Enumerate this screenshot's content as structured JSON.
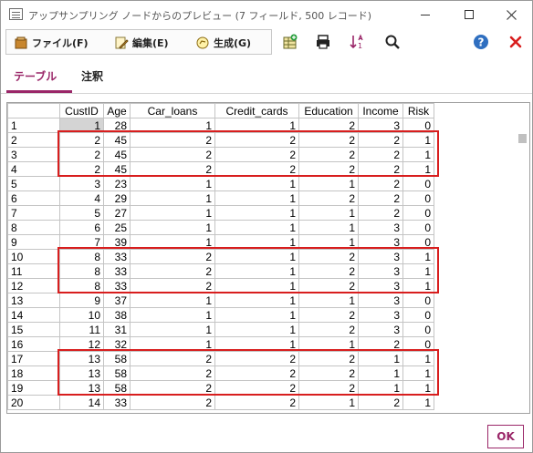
{
  "window": {
    "title": "アップサンプリング ノードからのプレビュー (7 フィールド, 500 レコード)"
  },
  "menu": {
    "file_label": "ファイル(F)",
    "edit_label": "編集(E)",
    "generate_label": "生成(G)"
  },
  "tabs": [
    {
      "label": "テーブル",
      "active": true
    },
    {
      "label": "注釈",
      "active": false
    }
  ],
  "table": {
    "columns": [
      "CustID",
      "Age",
      "Car_loans",
      "Credit_cards",
      "Education",
      "Income",
      "Risk"
    ],
    "rows": [
      [
        "1",
        "1",
        "28",
        "1",
        "1",
        "2",
        "3",
        "0"
      ],
      [
        "2",
        "2",
        "45",
        "2",
        "2",
        "2",
        "2",
        "1"
      ],
      [
        "3",
        "2",
        "45",
        "2",
        "2",
        "2",
        "2",
        "1"
      ],
      [
        "4",
        "2",
        "45",
        "2",
        "2",
        "2",
        "2",
        "1"
      ],
      [
        "5",
        "3",
        "23",
        "1",
        "1",
        "1",
        "2",
        "0"
      ],
      [
        "6",
        "4",
        "29",
        "1",
        "1",
        "2",
        "2",
        "0"
      ],
      [
        "7",
        "5",
        "27",
        "1",
        "1",
        "1",
        "2",
        "0"
      ],
      [
        "8",
        "6",
        "25",
        "1",
        "1",
        "1",
        "3",
        "0"
      ],
      [
        "9",
        "7",
        "39",
        "1",
        "1",
        "1",
        "3",
        "0"
      ],
      [
        "10",
        "8",
        "33",
        "2",
        "1",
        "2",
        "3",
        "1"
      ],
      [
        "11",
        "8",
        "33",
        "2",
        "1",
        "2",
        "3",
        "1"
      ],
      [
        "12",
        "8",
        "33",
        "2",
        "1",
        "2",
        "3",
        "1"
      ],
      [
        "13",
        "9",
        "37",
        "1",
        "1",
        "1",
        "3",
        "0"
      ],
      [
        "14",
        "10",
        "38",
        "1",
        "1",
        "2",
        "3",
        "0"
      ],
      [
        "15",
        "11",
        "31",
        "1",
        "1",
        "2",
        "3",
        "0"
      ],
      [
        "16",
        "12",
        "32",
        "1",
        "1",
        "1",
        "2",
        "0"
      ],
      [
        "17",
        "13",
        "58",
        "2",
        "2",
        "2",
        "1",
        "1"
      ],
      [
        "18",
        "13",
        "58",
        "2",
        "2",
        "2",
        "1",
        "1"
      ],
      [
        "19",
        "13",
        "58",
        "2",
        "2",
        "2",
        "1",
        "1"
      ],
      [
        "20",
        "14",
        "33",
        "2",
        "2",
        "1",
        "2",
        "1"
      ]
    ]
  },
  "highlight_groups": [
    {
      "from_row": 2,
      "to_row": 4
    },
    {
      "from_row": 10,
      "to_row": 12
    },
    {
      "from_row": 17,
      "to_row": 19
    }
  ],
  "footer": {
    "ok_label": "OK"
  },
  "colors": {
    "accent": "#9a2668",
    "highlight": "#d81e1e",
    "help": "#2f6fc0",
    "close": "#d81e1e"
  }
}
